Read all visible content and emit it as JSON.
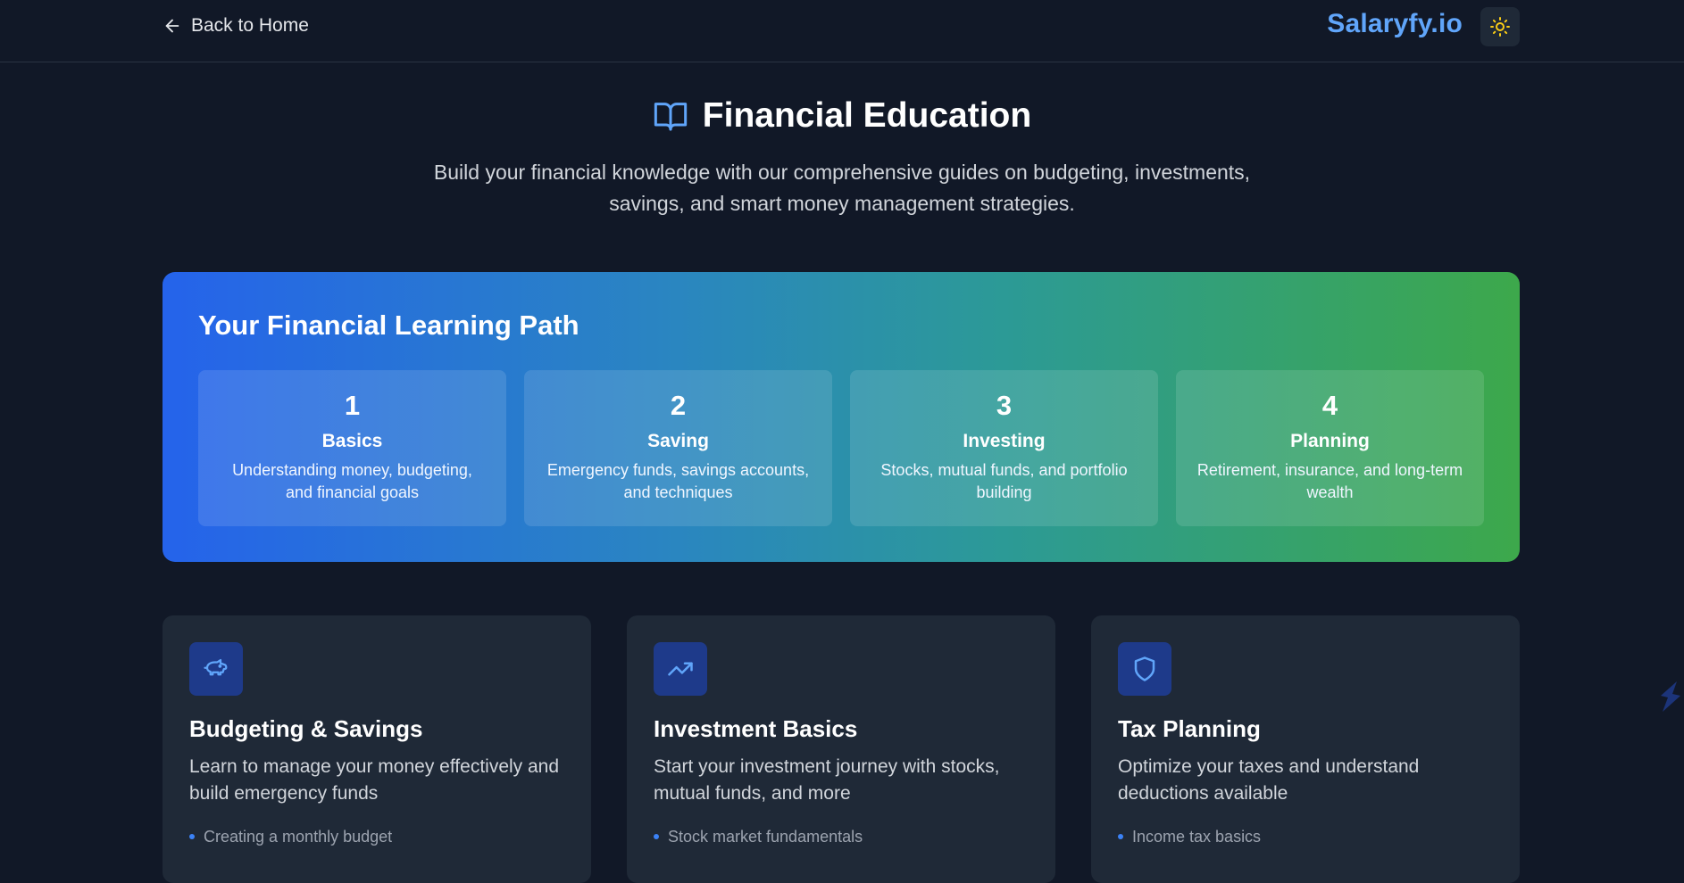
{
  "header": {
    "back_label": "Back to Home",
    "brand": "Salaryfy.io",
    "theme_icon": "sun-icon"
  },
  "hero": {
    "icon": "book-open-icon",
    "title": "Financial Education",
    "subtitle": "Build your financial knowledge with our comprehensive guides on budgeting, investments, savings, and smart money management strategies."
  },
  "learning_path": {
    "title": "Your Financial Learning Path",
    "steps": [
      {
        "number": "1",
        "name": "Basics",
        "desc": "Understanding money, budgeting, and financial goals"
      },
      {
        "number": "2",
        "name": "Saving",
        "desc": "Emergency funds, savings accounts, and techniques"
      },
      {
        "number": "3",
        "name": "Investing",
        "desc": "Stocks, mutual funds, and portfolio building"
      },
      {
        "number": "4",
        "name": "Planning",
        "desc": "Retirement, insurance, and long-term wealth"
      }
    ]
  },
  "cards": [
    {
      "icon": "piggy-bank-icon",
      "title": "Budgeting & Savings",
      "desc": "Learn to manage your money effectively and build emergency funds",
      "items": [
        "Creating a monthly budget"
      ]
    },
    {
      "icon": "trending-up-icon",
      "title": "Investment Basics",
      "desc": "Start your investment journey with stocks, mutual funds, and more",
      "items": [
        "Stock market fundamentals"
      ]
    },
    {
      "icon": "shield-icon",
      "title": "Tax Planning",
      "desc": "Optimize your taxes and understand deductions available",
      "items": [
        "Income tax basics"
      ]
    }
  ],
  "colors": {
    "background": "#111827",
    "card": "#1f2937",
    "accent": "#60a5fa",
    "gradient_start": "#2563eb",
    "gradient_end": "#3da84b"
  }
}
